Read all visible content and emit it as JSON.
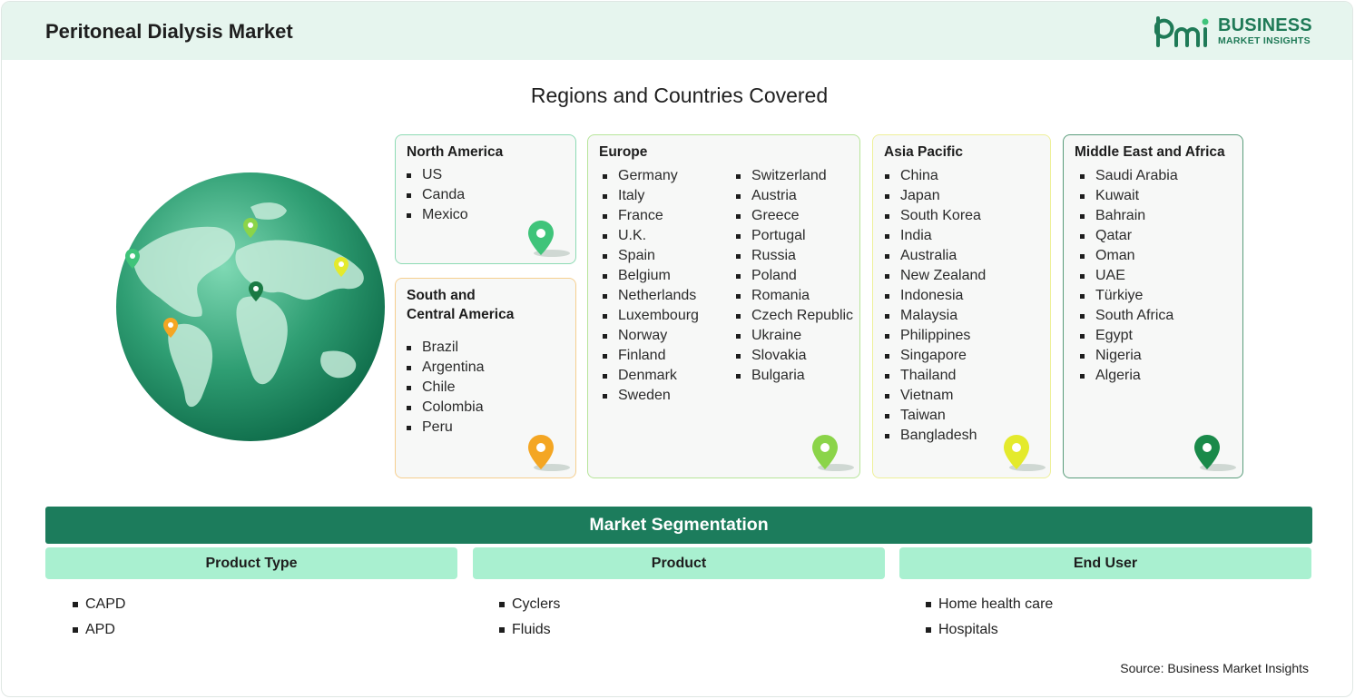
{
  "header": {
    "title": "Peritoneal Dialysis Market"
  },
  "logo": {
    "line1": "BUSINESS",
    "line2": "MARKET INSIGHTS"
  },
  "regions_title": "Regions and Countries Covered",
  "regions": {
    "north_america": {
      "title": "North America",
      "countries": [
        "US",
        "Canda",
        "Mexico"
      ],
      "pin_color": "#3fc47a"
    },
    "south_central_america": {
      "title_line1": "South and",
      "title_line2": "Central America",
      "countries": [
        "Brazil",
        "Argentina",
        "Chile",
        "Colombia",
        "Peru"
      ],
      "pin_color": "#f4a623"
    },
    "europe": {
      "title": "Europe",
      "col1": [
        "Germany",
        "Italy",
        "France",
        "U.K.",
        "Spain",
        "Belgium",
        "Netherlands",
        "Luxembourg",
        "Norway",
        "Finland",
        "Denmark",
        "Sweden"
      ],
      "col2": [
        "Switzerland",
        "Austria",
        "Greece",
        "Portugal",
        "Russia",
        "Poland",
        "Romania",
        "Czech Republic",
        "Ukraine",
        "Slovakia",
        "Bulgaria"
      ],
      "pin_color": "#8bd449"
    },
    "asia_pacific": {
      "title": "Asia Pacific",
      "countries": [
        "China",
        "Japan",
        "South Korea",
        "India",
        "Australia",
        "New Zealand",
        "Indonesia",
        "Malaysia",
        "Philippines",
        "Singapore",
        "Thailand",
        "Vietnam",
        "Taiwan",
        "Bangladesh"
      ],
      "pin_color": "#e4ea2c"
    },
    "middle_east_africa": {
      "title": "Middle East and Africa",
      "countries": [
        "Saudi Arabia",
        "Kuwait",
        "Bahrain",
        "Qatar",
        "Oman",
        "UAE",
        "Türkiye",
        "South Africa",
        "Egypt",
        "Nigeria",
        "Algeria"
      ],
      "pin_color": "#1a8a4a"
    }
  },
  "segmentation": {
    "title": "Market Segmentation",
    "columns": [
      {
        "heading": "Product Type",
        "items": [
          "CAPD",
          "APD"
        ]
      },
      {
        "heading": "Product",
        "items": [
          "Cyclers",
          "Fluids"
        ]
      },
      {
        "heading": "End User",
        "items": [
          "Home health care",
          "Hospitals"
        ]
      }
    ]
  },
  "source": "Source: Business Market Insights"
}
